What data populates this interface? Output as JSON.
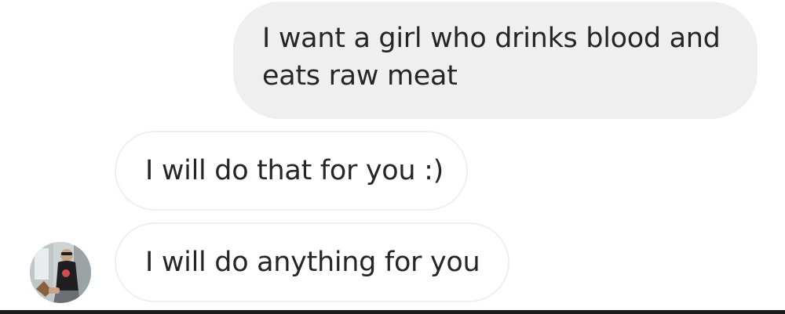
{
  "messages": [
    {
      "direction": "sent",
      "text": "I want a girl who drinks blood and eats raw meat"
    },
    {
      "direction": "received",
      "text": "I will do that for you :)"
    },
    {
      "direction": "received",
      "text": "I will do anything for you"
    }
  ],
  "avatar": {
    "icon": "profile-photo",
    "description_colors": {
      "bg": "#d9d9d9"
    }
  },
  "colors": {
    "sent_bubble": "#efefef",
    "received_border": "#efefef",
    "text": "#262626"
  }
}
